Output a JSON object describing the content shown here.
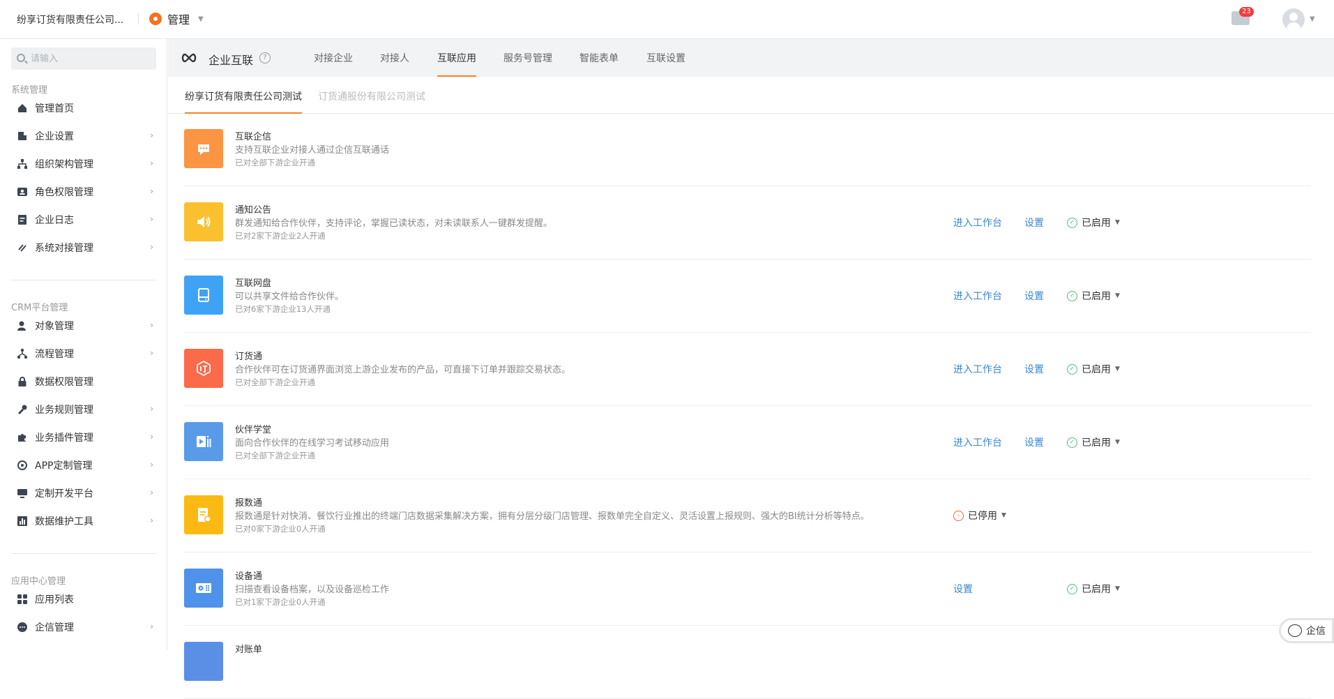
{
  "topbar": {
    "company": "纷享订货有限责任公司...",
    "brand": "管理",
    "mail_badge": "23"
  },
  "sidebar": {
    "search_placeholder": "请输入",
    "sections": [
      {
        "title": "系统管理",
        "items": [
          {
            "label": "管理首页",
            "icon": "home-icon",
            "chevron": false
          },
          {
            "label": "企业设置",
            "icon": "building-icon",
            "chevron": true
          },
          {
            "label": "组织架构管理",
            "icon": "org-icon",
            "chevron": true
          },
          {
            "label": "角色权限管理",
            "icon": "role-icon",
            "chevron": true
          },
          {
            "label": "企业日志",
            "icon": "log-icon",
            "chevron": true
          },
          {
            "label": "系统对接管理",
            "icon": "link-icon",
            "chevron": true
          }
        ]
      },
      {
        "title": "CRM平台管理",
        "items": [
          {
            "label": "对象管理",
            "icon": "object-icon",
            "chevron": true
          },
          {
            "label": "流程管理",
            "icon": "flow-icon",
            "chevron": true
          },
          {
            "label": "数据权限管理",
            "icon": "lock-icon",
            "chevron": false
          },
          {
            "label": "业务规则管理",
            "icon": "wrench-icon",
            "chevron": true
          },
          {
            "label": "业务插件管理",
            "icon": "puzzle-icon",
            "chevron": true
          },
          {
            "label": "APP定制管理",
            "icon": "app-icon",
            "chevron": true
          },
          {
            "label": "定制开发平台",
            "icon": "monitor-icon",
            "chevron": true
          },
          {
            "label": "数据维护工具",
            "icon": "chart-icon",
            "chevron": true
          }
        ]
      },
      {
        "title": "应用中心管理",
        "items": [
          {
            "label": "应用列表",
            "icon": "grid-icon",
            "chevron": false
          },
          {
            "label": "企信管理",
            "icon": "chat-icon",
            "chevron": true
          }
        ]
      }
    ]
  },
  "header": {
    "title": "企业互联",
    "help": "?",
    "tabs": [
      "对接企业",
      "对接人",
      "互联应用",
      "服务号管理",
      "智能表单",
      "互联设置"
    ]
  },
  "sub_tabs": [
    "纷享订货有限责任公司测试",
    "订货通股份有限公司测试"
  ],
  "actions": {
    "enter": "进入工作台",
    "settings": "设置"
  },
  "apps": [
    {
      "name": "互联企信",
      "desc": "支持互联企业对接人通过企信互联通话",
      "scope": "已对全部下游企业开通",
      "color": "#fb9443",
      "icon": "message-icon",
      "enter": false,
      "settings": false,
      "status": ""
    },
    {
      "name": "通知公告",
      "desc": "群发通知给合作伙伴，支持评论，掌握已读状态，对未读联系人一键群发提醒。",
      "scope": "已对2家下游企业2人开通",
      "color": "#fbc02d",
      "icon": "speaker-icon",
      "enter": true,
      "settings": true,
      "status": "已启用"
    },
    {
      "name": "互联网盘",
      "desc": "可以共享文件给合作伙伴。",
      "scope": "已对6家下游企业13人开通",
      "color": "#3ea3f5",
      "icon": "drive-icon",
      "enter": true,
      "settings": true,
      "status": "已启用"
    },
    {
      "name": "订货通",
      "desc": "合作伙伴可在订货通界面浏览上游企业发布的产品，可直接下订单并跟踪交易状态。",
      "scope": "已对全部下游企业开通",
      "color": "#fb6a4a",
      "icon": "order-icon",
      "enter": true,
      "settings": true,
      "status": "已启用"
    },
    {
      "name": "伙伴学堂",
      "desc": "面向合作伙伴的在线学习考试移动应用",
      "scope": "已对全部下游企业开通",
      "color": "#5a9be9",
      "icon": "video-icon",
      "enter": true,
      "settings": true,
      "status": "已启用"
    },
    {
      "name": "报数通",
      "desc": "报数通是针对快消、餐饮行业推出的终端门店数据采集解决方案，拥有分层分级门店管理、报数单完全自定义、灵活设置上报规则、强大的BI统计分析等特点。",
      "scope": "已对0家下游企业0人开通",
      "color": "#fbb914",
      "icon": "report-icon",
      "enter": false,
      "settings": false,
      "status": "已停用"
    },
    {
      "name": "设备通",
      "desc": "扫描查看设备档案，以及设备巡检工作",
      "scope": "已对1家下游企业0人开通",
      "color": "#4e92ea",
      "icon": "device-icon",
      "enter": false,
      "settings": true,
      "status": "已启用"
    },
    {
      "name": "对账单",
      "desc": "",
      "scope": "",
      "color": "#5b8fe6",
      "icon": "statement-icon",
      "enter": false,
      "settings": false,
      "status": ""
    }
  ],
  "float_chat": "企信"
}
